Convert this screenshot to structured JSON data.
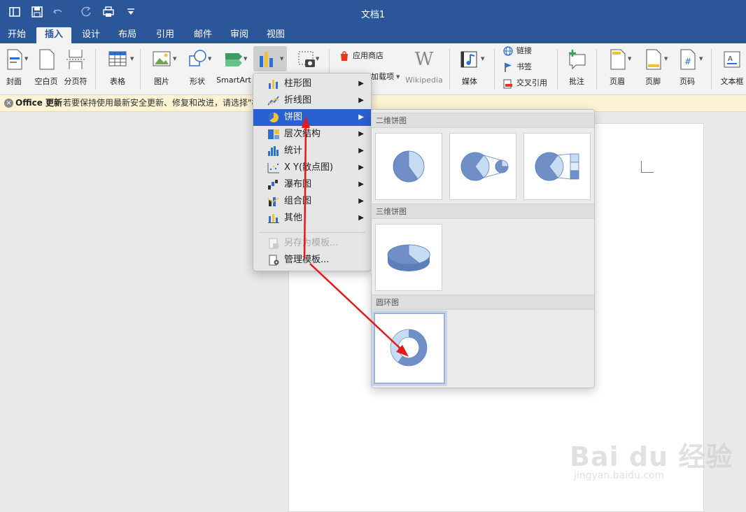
{
  "window": {
    "title": "文档1"
  },
  "tabs": [
    {
      "label": "开始",
      "active": false
    },
    {
      "label": "插入",
      "active": true
    },
    {
      "label": "设计",
      "active": false
    },
    {
      "label": "布局",
      "active": false
    },
    {
      "label": "引用",
      "active": false
    },
    {
      "label": "邮件",
      "active": false
    },
    {
      "label": "审阅",
      "active": false
    },
    {
      "label": "视图",
      "active": false
    }
  ],
  "ribbon": {
    "cover": "封面",
    "blank_page": "空白页",
    "page_break": "分页符",
    "table": "表格",
    "picture": "图片",
    "shape": "形状",
    "smartart": "SmartArt",
    "app_store": "应用商店",
    "addins": "加载项",
    "wikipedia": "Wikipedia",
    "media": "媒体",
    "link": "链接",
    "bookmark": "书签",
    "cross_ref": "交叉引用",
    "comment": "批注",
    "header": "页眉",
    "footer": "页脚",
    "page_number": "页码",
    "textbox": "文本框"
  },
  "notification": {
    "title": "Office 更新",
    "text": "若要保持使用最新安全更新、修复和改进，请选择\"检"
  },
  "chart_menu": {
    "items": [
      {
        "label": "柱形图",
        "icon": "column-chart-icon"
      },
      {
        "label": "折线图",
        "icon": "line-chart-icon"
      },
      {
        "label": "饼图",
        "icon": "pie-chart-icon",
        "selected": true
      },
      {
        "label": "层次结构",
        "icon": "hierarchy-chart-icon"
      },
      {
        "label": "统计",
        "icon": "statistic-chart-icon"
      },
      {
        "label": "X Y(散点图)",
        "icon": "scatter-chart-icon"
      },
      {
        "label": "瀑布图",
        "icon": "waterfall-chart-icon"
      },
      {
        "label": "组合图",
        "icon": "combo-chart-icon"
      },
      {
        "label": "其他",
        "icon": "other-chart-icon"
      }
    ],
    "save_template": "另存为模板...",
    "manage_templates": "管理模板..."
  },
  "gallery": {
    "pie2d": "二维饼图",
    "pie3d": "三维饼图",
    "doughnut": "圆环图"
  },
  "watermark": {
    "brand": "Bai du 经验",
    "url": "jingyan.baidu.com"
  },
  "colors": {
    "title_blue": "#2b579a",
    "selected_blue": "#2a5fd2",
    "annotation_red": "#e8171a",
    "pie_dark": "#6f8fc6",
    "pie_light": "#c6dcf2"
  }
}
